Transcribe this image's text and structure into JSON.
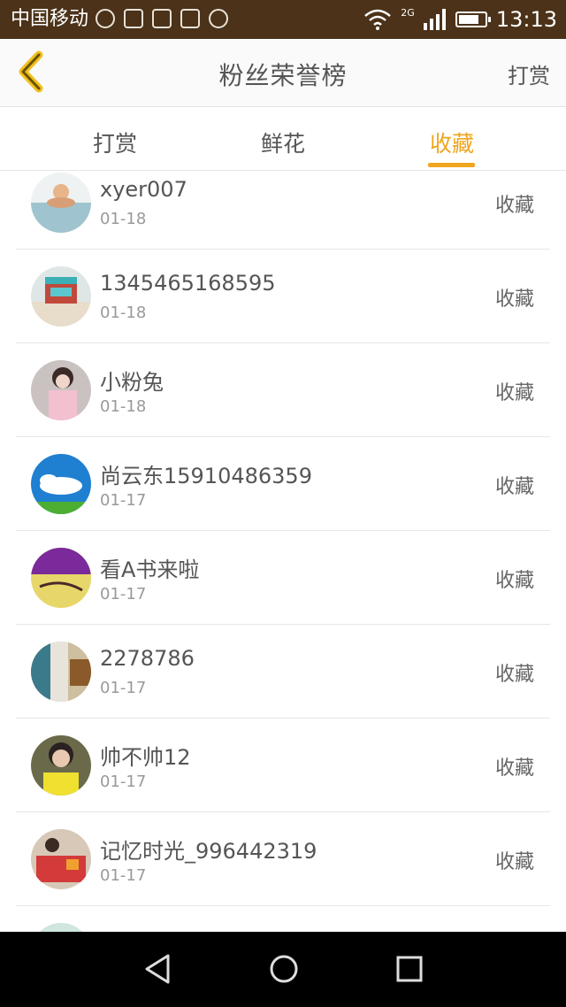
{
  "status_bar": {
    "carrier": "中国移动",
    "network": "2G",
    "time": "13:13"
  },
  "header": {
    "title": "粉丝荣誉榜",
    "action": "打赏",
    "accent_color": "#f0a51f"
  },
  "tabs": [
    {
      "label": "打赏",
      "active": false
    },
    {
      "label": "鲜花",
      "active": false
    },
    {
      "label": "收藏",
      "active": true
    }
  ],
  "list": [
    {
      "name": "xyer007",
      "date": "01-18",
      "action": "收藏"
    },
    {
      "name": "1345465168595",
      "date": "01-18",
      "action": "收藏"
    },
    {
      "name": "小粉兔",
      "date": "01-18",
      "action": "收藏"
    },
    {
      "name": "尚云东15910486359",
      "date": "01-17",
      "action": "收藏"
    },
    {
      "name": "看A书来啦",
      "date": "01-17",
      "action": "收藏"
    },
    {
      "name": "2278786",
      "date": "01-17",
      "action": "收藏"
    },
    {
      "name": "帅不帅12",
      "date": "01-17",
      "action": "收藏"
    },
    {
      "name": "记忆时光_996442319",
      "date": "01-17",
      "action": "收藏"
    }
  ]
}
